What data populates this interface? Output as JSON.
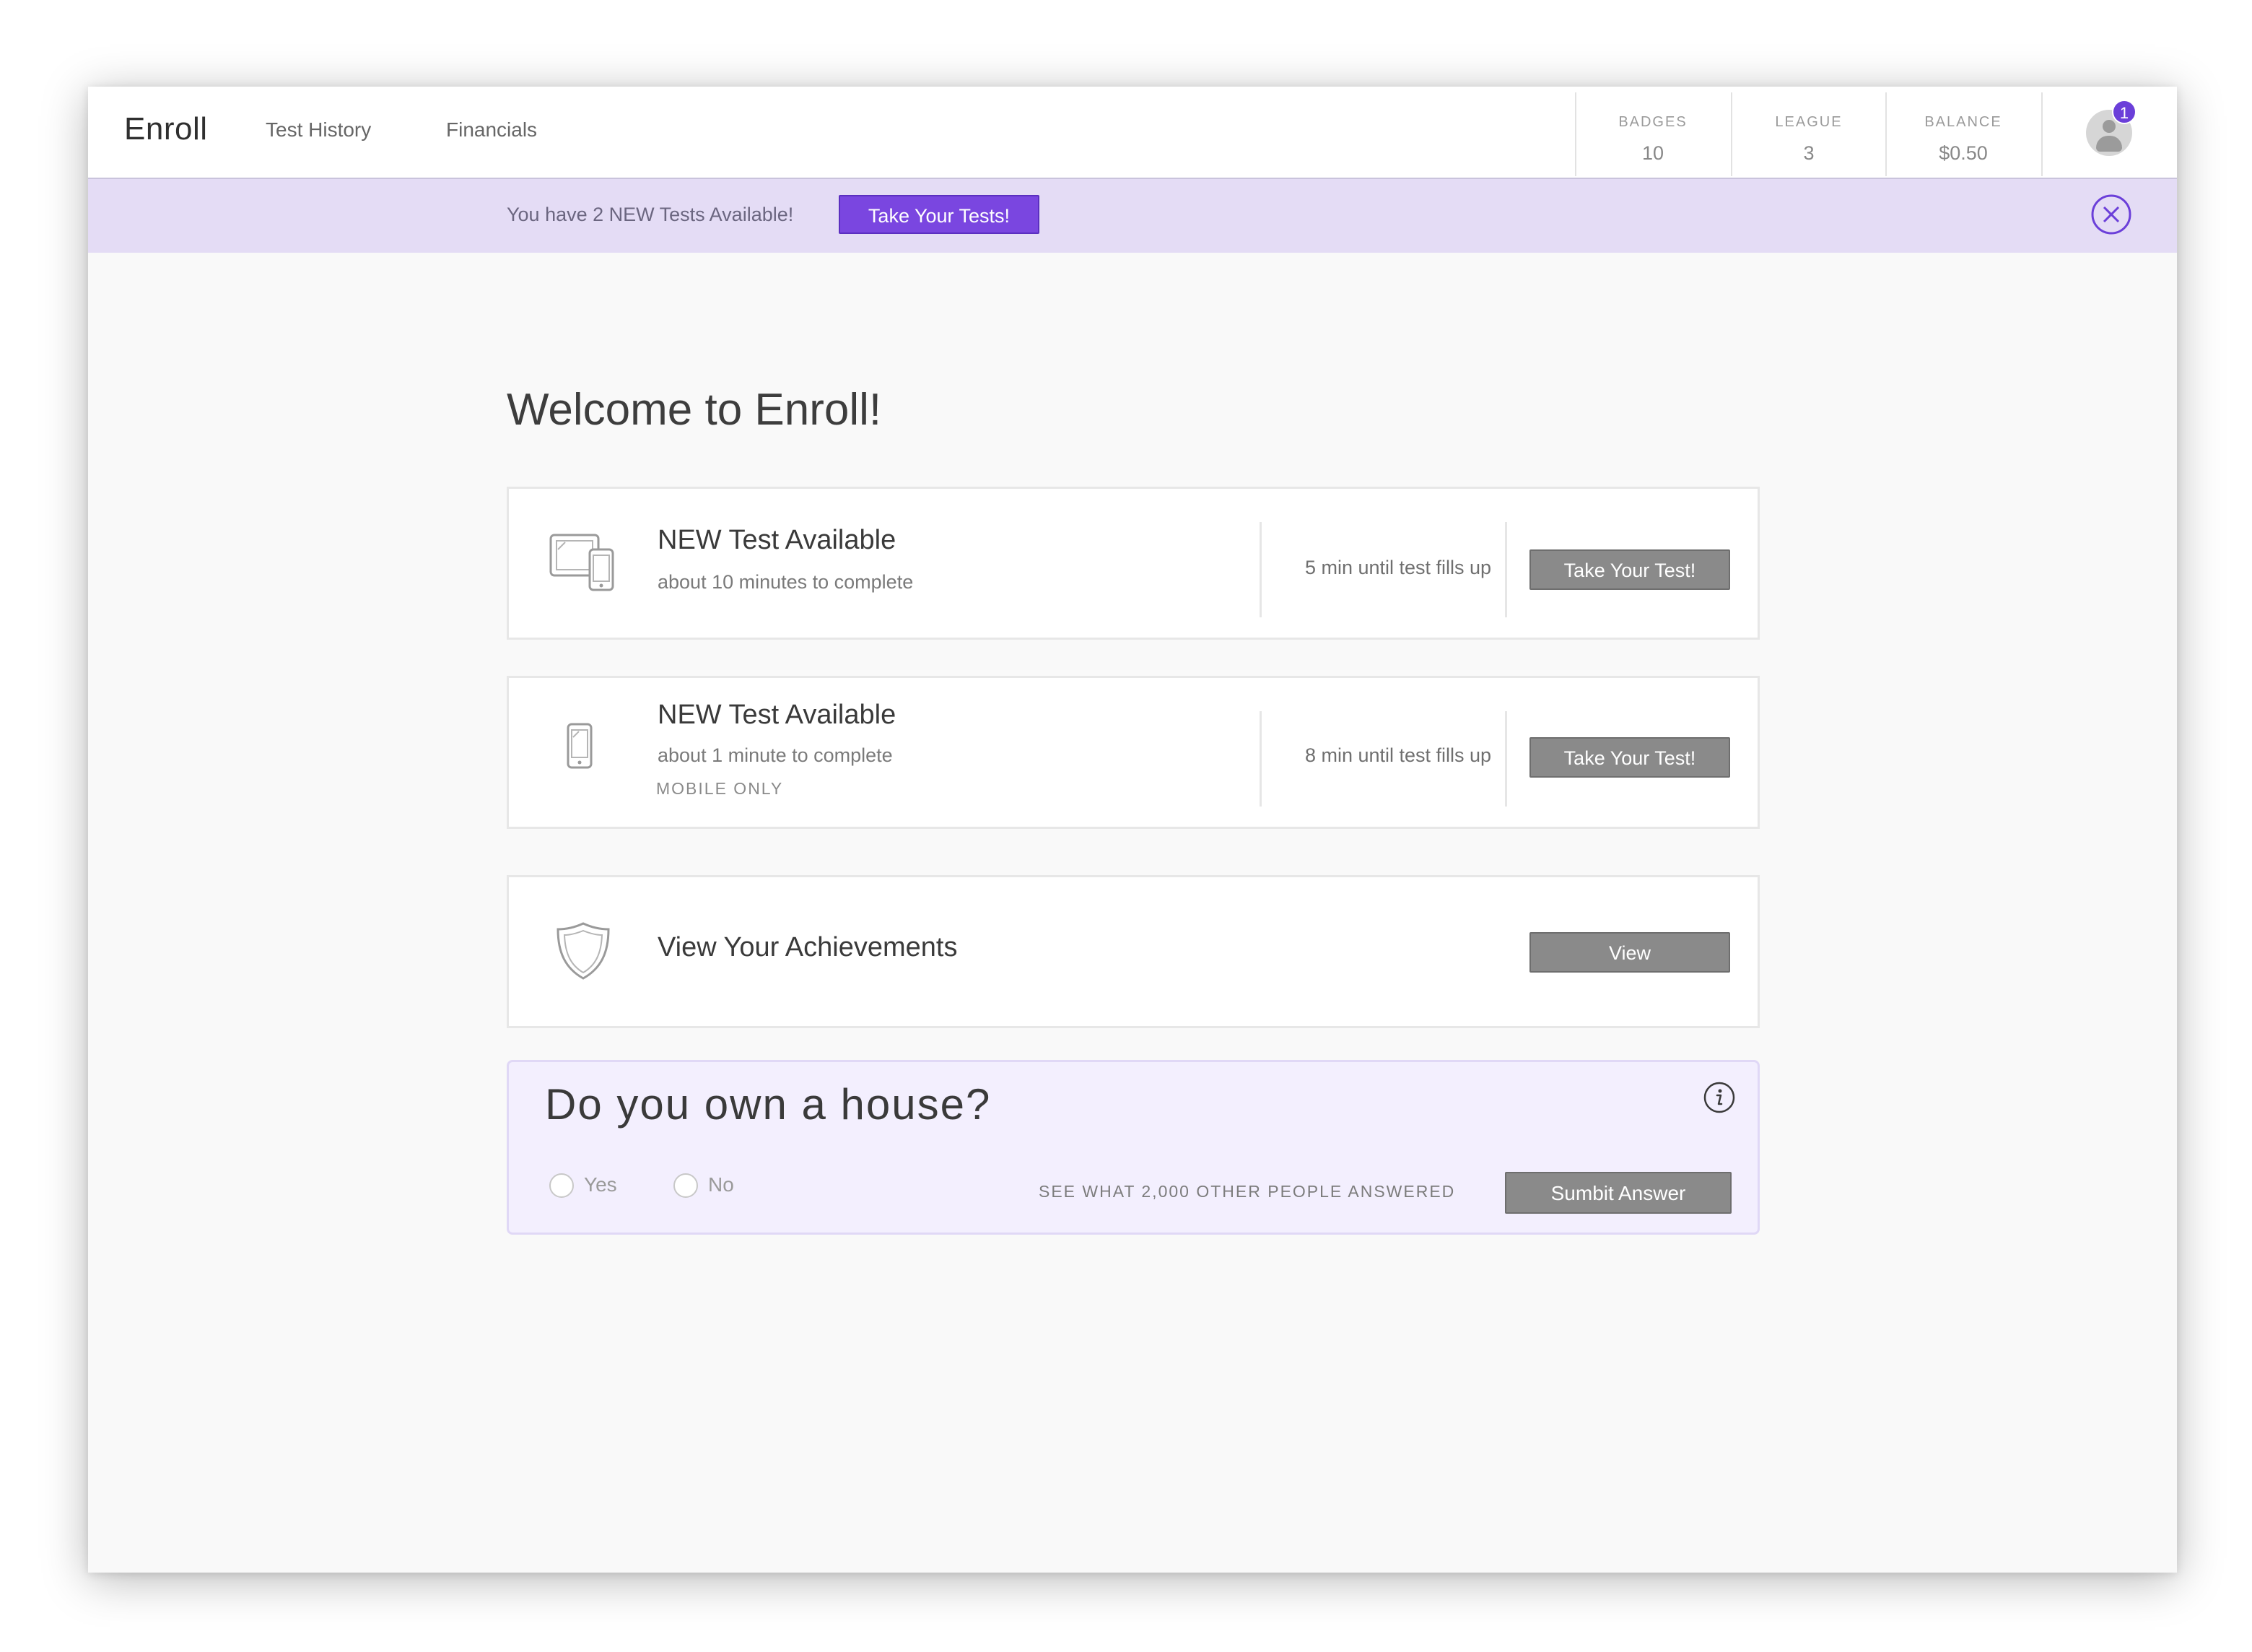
{
  "nav": {
    "brand": "Enroll",
    "links": [
      "Test History",
      "Financials"
    ]
  },
  "stats": [
    {
      "label": "BADGES",
      "value": "10"
    },
    {
      "label": "LEAGUE",
      "value": "3"
    },
    {
      "label": "BALANCE",
      "value": "$0.50"
    }
  ],
  "notifications": {
    "count": "1"
  },
  "banner": {
    "text": "You have 2 NEW Tests Available!",
    "button": "Take Your Tests!"
  },
  "main": {
    "title": "Welcome to Enroll!",
    "tests": [
      {
        "icon": "devices-icon",
        "title": "NEW Test Available",
        "subtitle": "about 10 minutes to complete",
        "tag": "",
        "fills": "5 min until test fills up",
        "button": "Take Your Test!"
      },
      {
        "icon": "phone-icon",
        "title": "NEW Test Available",
        "subtitle": "about 1 minute to complete",
        "tag": "MOBILE ONLY",
        "fills": "8 min until test fills up",
        "button": "Take Your Test!"
      }
    ],
    "achievements": {
      "icon": "shield-icon",
      "title": "View Your Achievements",
      "button": "View"
    },
    "poll": {
      "question": "Do you own a house?",
      "options": [
        "Yes",
        "No"
      ],
      "see_link": "SEE WHAT 2,000 OTHER PEOPLE ANSWERED",
      "submit": "Sumbit Answer"
    }
  },
  "colors": {
    "accent": "#7a46e0",
    "banner_bg": "#e4dcf5",
    "poll_bg": "#f3effe",
    "button_gray": "#8a8a8a"
  }
}
